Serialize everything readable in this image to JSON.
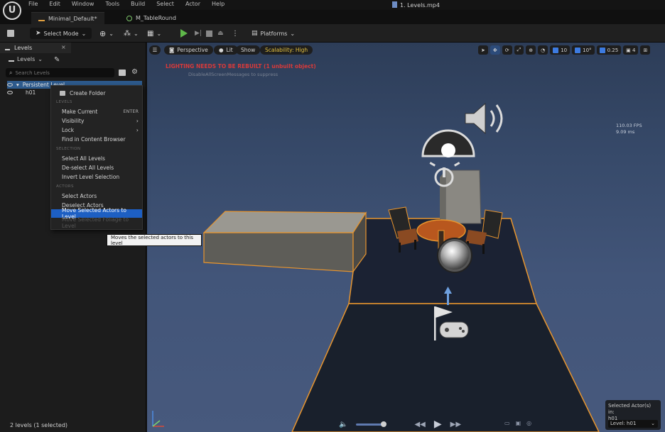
{
  "app": {
    "logo_letter": "U",
    "menu": [
      "File",
      "Edit",
      "Window",
      "Tools",
      "Build",
      "Select",
      "Actor",
      "Help"
    ],
    "window_title": "1. Levels.mp4"
  },
  "tabs": [
    {
      "label": "Minimal_Default*"
    },
    {
      "label": "M_TableRound"
    }
  ],
  "toolbar": {
    "select_mode": "Select Mode",
    "platforms": "Platforms"
  },
  "levels_panel": {
    "tab_label": "Levels",
    "close": "×",
    "dropdown_label": "Levels",
    "search_placeholder": "Search Levels",
    "rows": [
      {
        "label": "Persistent Level"
      },
      {
        "label": "h01"
      }
    ],
    "status": "2 levels (1 selected)"
  },
  "context_menu": {
    "create_folder": "Create Folder",
    "section_levels": "LEVELS",
    "make_current": "Make Current",
    "make_current_shortcut": "ENTER",
    "visibility": "Visibility",
    "lock": "Lock",
    "find_in_cb": "Find in Content Browser",
    "section_selection": "SELECTION",
    "select_all_levels": "Select All Levels",
    "deselect_all_levels": "De-select All Levels",
    "invert_level_selection": "Invert Level Selection",
    "section_actors": "ACTORS",
    "select_actors": "Select Actors",
    "deselect_actors": "Deselect Actors",
    "move_selected_actors": "Move Selected Actors to Level",
    "move_selected_foliage": "Move Selected Foliage to Level"
  },
  "tooltip": "Moves the selected actors to this level",
  "viewport": {
    "perspective": "Perspective",
    "lit": "Lit",
    "show": "Show",
    "scalability": "Scalability: High",
    "lighting_warning": "LIGHTING NEEDS TO BE REBUILT (1 unbuilt object)",
    "lighting_sub": "DisableAllScreenMessages to suppress",
    "fps": "110.03 FPS",
    "ms": "9.09 ms",
    "grid_snap": "10",
    "rot_snap": "10°",
    "scale_snap": "0.25",
    "camera_speed": "4",
    "selected_actors_label": "Selected Actor(s) in:",
    "selected_level": "h01",
    "level_select": "Level: h01"
  },
  "colors": {
    "accent_blue": "#1d5fc3",
    "warning_red": "#d83a3a",
    "selection_orange": "#e8952e",
    "play_green": "#5fb84a"
  }
}
